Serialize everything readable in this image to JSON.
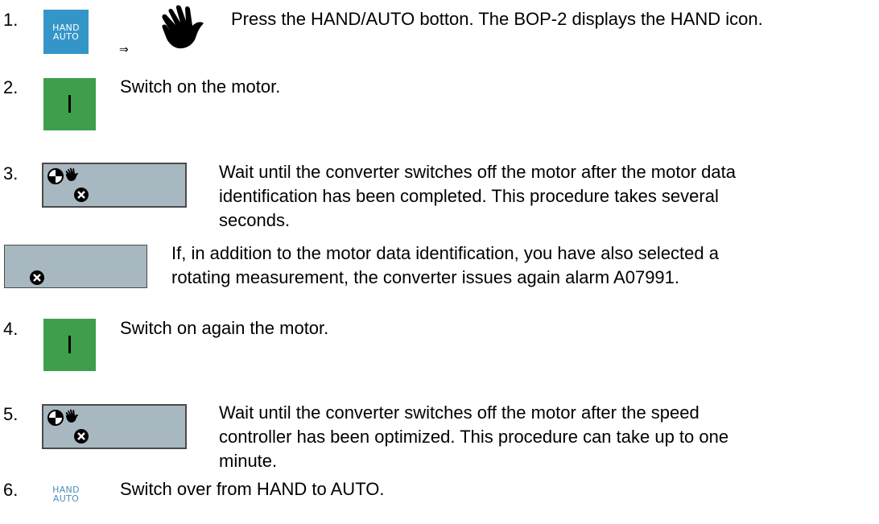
{
  "steps": [
    {
      "number": "1.",
      "button_label_line1": "HAND",
      "button_label_line2": "AUTO",
      "arrow": "⇒",
      "text": "Press the HAND/AUTO botton. The BOP-2 displays the HAND icon."
    },
    {
      "number": "2.",
      "text": "Switch on the motor."
    },
    {
      "number": "3.",
      "text_lines": [
        "Wait until the converter switches off the motor after the motor data",
        "identification has been completed. This procedure takes several",
        "seconds."
      ]
    },
    {
      "text_lines": [
        "If, in addition to the motor data identification, you have also selected a",
        "rotating measurement, the converter issues again alarm A07991."
      ]
    },
    {
      "number": "4.",
      "text": "Switch on again the motor."
    },
    {
      "number": "5.",
      "text_lines": [
        "Wait until the converter switches off the motor after the speed",
        "controller has been optimized. This procedure can take up to one",
        "minute."
      ]
    },
    {
      "number": "6.",
      "button_label_line1": "HAND",
      "button_label_line2": "AUTO",
      "text": "Switch over from HAND to AUTO."
    }
  ],
  "icons": {
    "hand": "hand-icon",
    "motor_id": "motor-identification-icon",
    "fault": "fault-cross-icon",
    "on": "on-icon"
  },
  "colors": {
    "hand_auto_button": "#3496c8",
    "on_button": "#3f9e4c",
    "display_background": "#a8b8c0"
  }
}
